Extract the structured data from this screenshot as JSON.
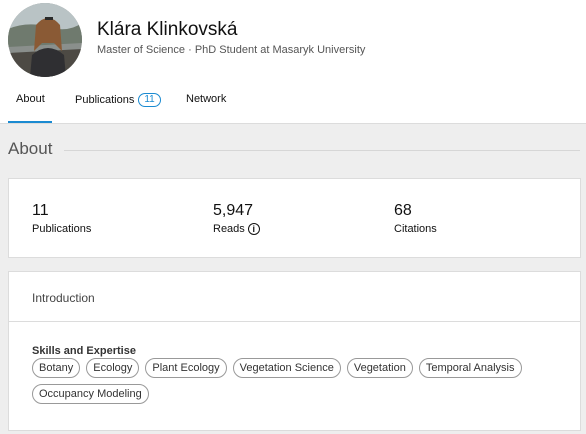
{
  "profile": {
    "name": "Klára Klinkovská",
    "subtitle": "Master of Science · PhD Student at Masaryk University"
  },
  "tabs": [
    {
      "label": "About",
      "active": true
    },
    {
      "label": "Publications",
      "badge": "11"
    },
    {
      "label": "Network"
    }
  ],
  "about": {
    "section_title": "About"
  },
  "stats": [
    {
      "value": "11",
      "label": "Publications"
    },
    {
      "value": "5,947",
      "label": "Reads",
      "icon": "info-icon"
    },
    {
      "value": "68",
      "label": "Citations"
    }
  ],
  "intro": {
    "title": "Introduction",
    "skills_title": "Skills and Expertise",
    "skills": [
      "Botany",
      "Ecology",
      "Plant Ecology",
      "Vegetation Science",
      "Vegetation",
      "Temporal Analysis",
      "Occupancy Modeling"
    ]
  },
  "colors": {
    "accent": "#1a8ad1",
    "background": "#eeeeee"
  }
}
